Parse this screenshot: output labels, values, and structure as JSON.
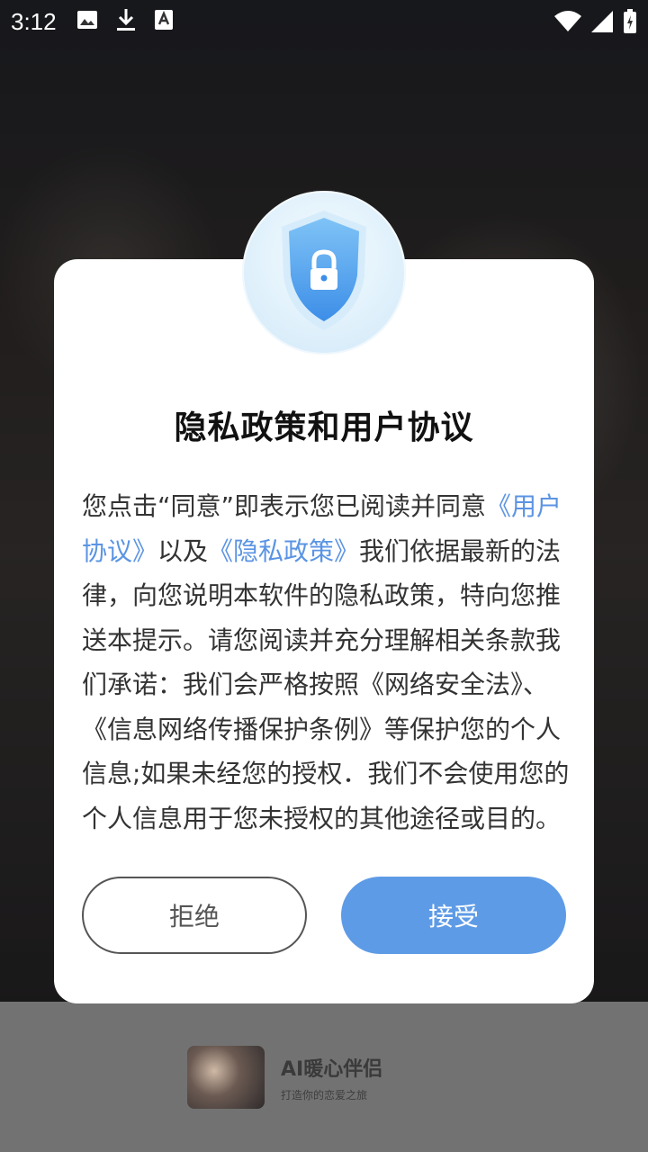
{
  "status_bar": {
    "time": "3:12",
    "left_icons": [
      "image-icon",
      "download-icon",
      "font-icon"
    ],
    "right_icons": [
      "wifi-icon",
      "signal-icon",
      "battery-icon"
    ]
  },
  "dialog": {
    "title": "隐私政策和用户协议",
    "body": {
      "p1": "您点击“同意”即表示您已阅读并同意",
      "link_user_agreement": "《用户协议》",
      "p2": "以及",
      "link_privacy_policy": "《隐私政策》",
      "p3": "我们依据最新的法律，向您说明本软件的隐私政策，特向您推送本提示。请您阅读并充分理解相关条款我们承诺：我们会严格按照《网络安全法》、《信息网络传播保护条例》等保护您的个人信息;如果未经您的授权．我们不会使用您的个人信息用于您未授权的其他途径或目的。"
    },
    "reject_label": "拒绝",
    "accept_label": "接受",
    "icon": "shield-lock-icon"
  },
  "footer": {
    "app_name": "AI暖心伴侣",
    "slogan": "打造你的恋爱之旅"
  },
  "colors": {
    "accent": "#5e9be6",
    "link": "#5b94e3"
  }
}
